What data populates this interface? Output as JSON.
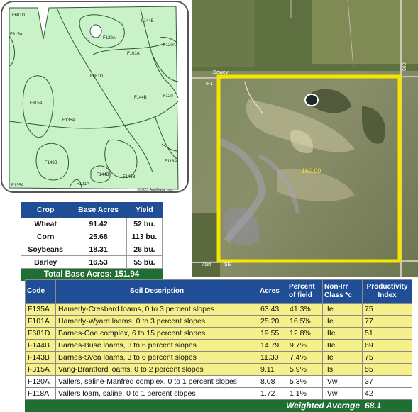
{
  "soil_map": {
    "labels": [
      "F681D",
      "F315A",
      "F144B",
      "F120A",
      "F101A",
      "F681D",
      "F120A",
      "F144B",
      "F120",
      "F315A",
      "F135A",
      "F143B",
      "F118A",
      "F144B",
      "F143B",
      "F101A",
      "F135A"
    ],
    "copyright": "©2025 AgriData, Inc."
  },
  "crop_table": {
    "headers": [
      "Crop",
      "Base Acres",
      "Yield"
    ],
    "rows": [
      {
        "crop": "Wheat",
        "acres": "91.42",
        "yield": "52 bu."
      },
      {
        "crop": "Corn",
        "acres": "25.68",
        "yield": "113 bu."
      },
      {
        "crop": "Soybeans",
        "acres": "18.31",
        "yield": "26 bu."
      },
      {
        "crop": "Barley",
        "acres": "16.53",
        "yield": "55 bu."
      }
    ],
    "total_label": "Total Base Acres:",
    "total_value": "151.94"
  },
  "aerial": {
    "road_labels": [
      "Dewey",
      "6-1",
      "560",
      "71st",
      "SE"
    ],
    "field_acres": "160.00",
    "boundary_color": "#f4e600"
  },
  "soil_table": {
    "headers": {
      "code": "Code",
      "description": "Soil Description",
      "acres": "Acres",
      "percent_line1": "Percent",
      "percent_line2": "of field",
      "class_line1": "Non-Irr",
      "class_line2": "Class *c",
      "pi_line1": "Productivity",
      "pi_line2": "Index"
    },
    "rows": [
      {
        "code": "F135A",
        "description": "Hamerly-Cresbard loams, 0 to 3 percent slopes",
        "acres": "63.43",
        "percent": "41.3%",
        "class": "IIe",
        "pi": "75",
        "highlight": true
      },
      {
        "code": "F101A",
        "description": "Hamerly-Wyard loams, 0 to 3 percent slopes",
        "acres": "25.20",
        "percent": "16.5%",
        "class": "IIe",
        "pi": "77",
        "highlight": true
      },
      {
        "code": "F681D",
        "description": "Barnes-Coe complex, 6 to 15 percent slopes",
        "acres": "19.55",
        "percent": "12.8%",
        "class": "IIIe",
        "pi": "51",
        "highlight": true
      },
      {
        "code": "F144B",
        "description": "Barnes-Buse loams, 3 to 6 percent slopes",
        "acres": "14.79",
        "percent": "9.7%",
        "class": "IIIe",
        "pi": "69",
        "highlight": true
      },
      {
        "code": "F143B",
        "description": "Barnes-Svea loams, 3 to 6 percent slopes",
        "acres": "11.30",
        "percent": "7.4%",
        "class": "IIe",
        "pi": "75",
        "highlight": true
      },
      {
        "code": "F315A",
        "description": "Vang-Brantford loams, 0 to 2 percent slopes",
        "acres": "9.11",
        "percent": "5.9%",
        "class": "IIs",
        "pi": "55",
        "highlight": true
      },
      {
        "code": "F120A",
        "description": "Vallers, saline-Manfred complex, 0 to 1 percent slopes",
        "acres": "8.08",
        "percent": "5.3%",
        "class": "IVw",
        "pi": "37",
        "highlight": false
      },
      {
        "code": "F118A",
        "description": "Vallers loam, saline, 0 to 1 percent slopes",
        "acres": "1.72",
        "percent": "1.1%",
        "class": "IVw",
        "pi": "42",
        "highlight": false
      }
    ],
    "weighted_average_label": "Weighted Average",
    "weighted_average_value": "68.1"
  },
  "colors": {
    "header_blue": "#1f4e96",
    "total_green": "#1f6f33",
    "row_highlight": "#f6f08a",
    "map_fill": "#c9f2c9"
  }
}
